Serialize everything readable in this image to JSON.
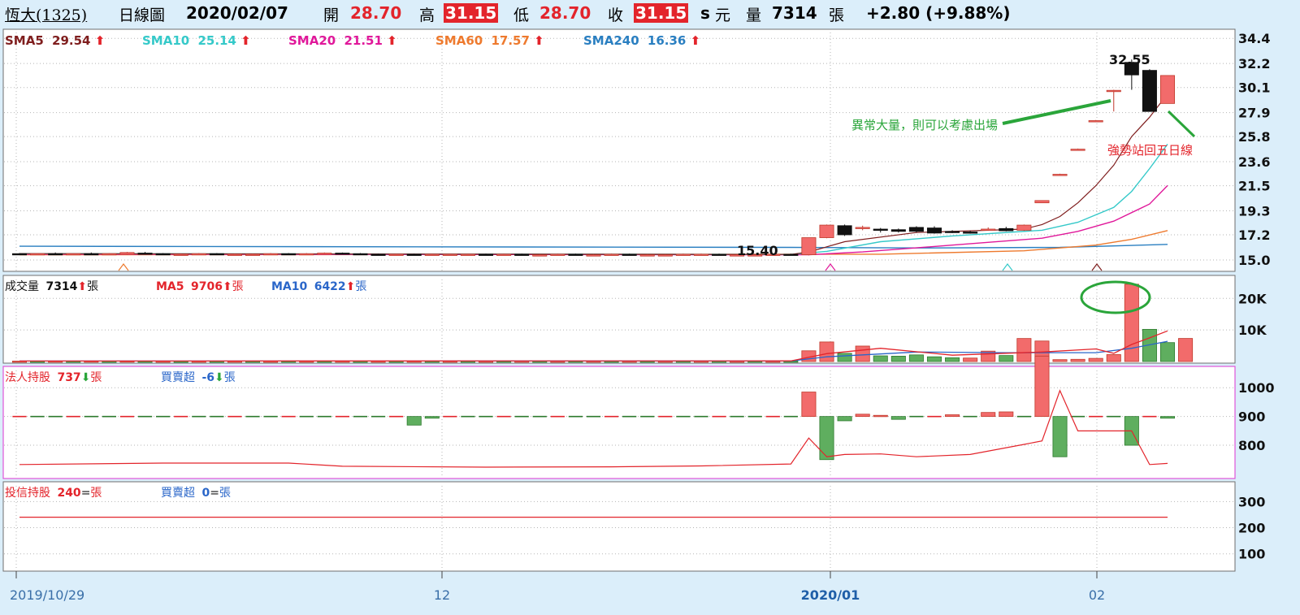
{
  "header": {
    "stock_name": "恆大(1325)",
    "chart_label": "日線圖",
    "date": "2020/02/07",
    "open_label": "開",
    "open": "28.70",
    "high_label": "高",
    "high": "31.15",
    "low_label": "低",
    "low": "28.70",
    "close_label": "收",
    "close": "31.15",
    "close_suffix": "s",
    "currency": "元",
    "volume_label": "量",
    "volume": "7314",
    "volume_unit": "張",
    "change": "+2.80 (+9.88%)"
  },
  "colors": {
    "up": "#f26b6b",
    "down": "#111111",
    "red": "#e3242b",
    "green": "#2aa53a",
    "sma5": "#7f1e1e",
    "sma10": "#35c9c9",
    "sma20": "#e0189a",
    "sma60": "#ee7a2e",
    "sma240": "#2a7fc1",
    "vol_ma5": "#e3242b",
    "vol_ma10": "#2a66c9",
    "accent": "#e3242b"
  },
  "chart_data": [
    {
      "type": "candlestick",
      "panel": "price",
      "indicators": [
        {
          "label": "SMA5",
          "value": "29.54"
        },
        {
          "label": "SMA10",
          "value": "25.14"
        },
        {
          "label": "SMA20",
          "value": "21.51"
        },
        {
          "label": "SMA60",
          "value": "17.57"
        },
        {
          "label": "SMA240",
          "value": "16.36"
        }
      ],
      "y_ticks": [
        "34.4",
        "32.2",
        "30.1",
        "27.9",
        "25.8",
        "23.6",
        "21.5",
        "19.3",
        "17.2",
        "15.0"
      ],
      "ylim": [
        14.0,
        35.2
      ],
      "x_ticks": [
        "2019/10/29",
        "12",
        "2020/01",
        "02"
      ],
      "min_label": "15.40",
      "max_label": "32.55",
      "annotations": [
        {
          "text": "異常大量，則可以考慮出場",
          "color": "green"
        },
        {
          "text": "強勢站回五日線",
          "color": "red"
        }
      ],
      "candles": [
        {
          "o": 15.55,
          "h": 15.6,
          "c": 15.5,
          "l": 15.45
        },
        {
          "o": 15.5,
          "h": 15.6,
          "c": 15.55,
          "l": 15.45
        },
        {
          "o": 15.55,
          "h": 15.65,
          "c": 15.5,
          "l": 15.45
        },
        {
          "o": 15.5,
          "h": 15.55,
          "c": 15.55,
          "l": 15.45
        },
        {
          "o": 15.55,
          "h": 15.65,
          "c": 15.5,
          "l": 15.5
        },
        {
          "o": 15.5,
          "h": 15.6,
          "c": 15.55,
          "l": 15.45
        },
        {
          "o": 15.5,
          "h": 15.7,
          "c": 15.65,
          "l": 15.45
        },
        {
          "o": 15.6,
          "h": 15.7,
          "c": 15.55,
          "l": 15.5
        },
        {
          "o": 15.55,
          "h": 15.6,
          "c": 15.5,
          "l": 15.45
        },
        {
          "o": 15.5,
          "h": 15.55,
          "c": 15.5,
          "l": 15.45
        },
        {
          "o": 15.5,
          "h": 15.6,
          "c": 15.55,
          "l": 15.45
        },
        {
          "o": 15.55,
          "h": 15.6,
          "c": 15.5,
          "l": 15.45
        },
        {
          "o": 15.5,
          "h": 15.55,
          "c": 15.5,
          "l": 15.45
        },
        {
          "o": 15.5,
          "h": 15.55,
          "c": 15.5,
          "l": 15.45
        },
        {
          "o": 15.5,
          "h": 15.6,
          "c": 15.55,
          "l": 15.45
        },
        {
          "o": 15.55,
          "h": 15.6,
          "c": 15.5,
          "l": 15.45
        },
        {
          "o": 15.5,
          "h": 15.6,
          "c": 15.55,
          "l": 15.45
        },
        {
          "o": 15.55,
          "h": 15.65,
          "c": 15.6,
          "l": 15.5
        },
        {
          "o": 15.6,
          "h": 15.65,
          "c": 15.55,
          "l": 15.5
        },
        {
          "o": 15.55,
          "h": 15.6,
          "c": 15.5,
          "l": 15.45
        },
        {
          "o": 15.5,
          "h": 15.55,
          "c": 15.45,
          "l": 15.4
        },
        {
          "o": 15.45,
          "h": 15.55,
          "c": 15.5,
          "l": 15.4
        },
        {
          "o": 15.5,
          "h": 15.55,
          "c": 15.45,
          "l": 15.4
        },
        {
          "o": 15.45,
          "h": 15.55,
          "c": 15.5,
          "l": 15.4
        },
        {
          "o": 15.5,
          "h": 15.55,
          "c": 15.5,
          "l": 15.45
        },
        {
          "o": 15.5,
          "h": 15.55,
          "c": 15.5,
          "l": 15.45
        },
        {
          "o": 15.5,
          "h": 15.55,
          "c": 15.45,
          "l": 15.4
        },
        {
          "o": 15.45,
          "h": 15.55,
          "c": 15.5,
          "l": 15.4
        },
        {
          "o": 15.5,
          "h": 15.55,
          "c": 15.45,
          "l": 15.4
        },
        {
          "o": 15.45,
          "h": 15.5,
          "c": 15.45,
          "l": 15.4
        },
        {
          "o": 15.45,
          "h": 15.55,
          "c": 15.5,
          "l": 15.4
        },
        {
          "o": 15.5,
          "h": 15.55,
          "c": 15.45,
          "l": 15.4
        },
        {
          "o": 15.45,
          "h": 15.5,
          "c": 15.45,
          "l": 15.4
        },
        {
          "o": 15.45,
          "h": 15.55,
          "c": 15.5,
          "l": 15.4
        },
        {
          "o": 15.5,
          "h": 15.55,
          "c": 15.45,
          "l": 15.4
        },
        {
          "o": 15.45,
          "h": 15.5,
          "c": 15.45,
          "l": 15.4
        },
        {
          "o": 15.45,
          "h": 15.5,
          "c": 15.45,
          "l": 15.4
        },
        {
          "o": 15.45,
          "h": 15.55,
          "c": 15.5,
          "l": 15.4
        },
        {
          "o": 15.5,
          "h": 15.55,
          "c": 15.5,
          "l": 15.45
        },
        {
          "o": 15.5,
          "h": 15.55,
          "c": 15.45,
          "l": 15.4
        },
        {
          "o": 15.45,
          "h": 15.5,
          "c": 15.45,
          "l": 15.4
        },
        {
          "o": 15.45,
          "h": 15.5,
          "c": 15.45,
          "l": 15.4
        },
        {
          "o": 15.45,
          "h": 15.55,
          "c": 15.5,
          "l": 15.4
        },
        {
          "o": 15.5,
          "h": 15.55,
          "c": 15.45,
          "l": 15.4
        },
        {
          "o": 15.45,
          "h": 16.95,
          "c": 16.95,
          "l": 15.4
        },
        {
          "o": 16.95,
          "h": 18.1,
          "c": 18.05,
          "l": 16.9
        },
        {
          "o": 18.0,
          "h": 18.1,
          "c": 17.2,
          "l": 17.1
        },
        {
          "o": 17.85,
          "h": 18.0,
          "c": 17.85,
          "l": 17.6
        },
        {
          "o": 17.7,
          "h": 17.8,
          "c": 17.6,
          "l": 17.4
        },
        {
          "o": 17.65,
          "h": 17.75,
          "c": 17.5,
          "l": 17.4
        },
        {
          "o": 17.85,
          "h": 17.95,
          "c": 17.5,
          "l": 17.4
        },
        {
          "o": 17.8,
          "h": 17.95,
          "c": 17.35,
          "l": 17.3
        },
        {
          "o": 17.5,
          "h": 17.6,
          "c": 17.45,
          "l": 17.35
        },
        {
          "o": 17.45,
          "h": 17.55,
          "c": 17.4,
          "l": 17.3
        },
        {
          "o": 17.6,
          "h": 17.85,
          "c": 17.7,
          "l": 17.55
        },
        {
          "o": 17.75,
          "h": 17.9,
          "c": 17.55,
          "l": 17.5
        },
        {
          "o": 17.6,
          "h": 18.1,
          "c": 18.05,
          "l": 17.55
        },
        {
          "o": 20.0,
          "h": 20.2,
          "c": 20.2,
          "l": 20.0
        },
        {
          "o": 22.5,
          "h": 22.55,
          "c": 22.5,
          "l": 22.5
        },
        {
          "o": 24.7,
          "h": 24.75,
          "c": 24.7,
          "l": 24.7
        },
        {
          "o": 27.2,
          "h": 27.25,
          "c": 27.2,
          "l": 27.2
        },
        {
          "o": 29.85,
          "h": 29.9,
          "c": 29.85,
          "l": 28.0
        },
        {
          "o": 32.3,
          "h": 32.55,
          "c": 31.2,
          "l": 29.9
        },
        {
          "o": 31.6,
          "h": 31.7,
          "c": 28.0,
          "l": 28.0
        },
        {
          "o": 28.7,
          "h": 31.15,
          "c": 31.15,
          "l": 28.7
        }
      ],
      "sma5": [
        [
          0,
          15.55
        ],
        [
          43,
          15.48
        ],
        [
          44,
          15.7
        ],
        [
          46,
          16.6
        ],
        [
          50,
          17.4
        ],
        [
          56,
          17.7
        ],
        [
          57,
          18.1
        ],
        [
          58,
          18.8
        ],
        [
          59,
          20.0
        ],
        [
          60,
          21.5
        ],
        [
          61,
          23.3
        ],
        [
          62,
          25.8
        ],
        [
          63,
          27.5
        ],
        [
          64,
          29.54
        ]
      ],
      "sma10": [
        [
          0,
          15.55
        ],
        [
          43,
          15.48
        ],
        [
          45,
          15.75
        ],
        [
          48,
          16.6
        ],
        [
          52,
          17.1
        ],
        [
          57,
          17.6
        ],
        [
          59,
          18.3
        ],
        [
          61,
          19.6
        ],
        [
          62,
          21.0
        ],
        [
          63,
          23.0
        ],
        [
          64,
          25.14
        ]
      ],
      "sma20": [
        [
          0,
          15.5
        ],
        [
          44,
          15.45
        ],
        [
          47,
          15.7
        ],
        [
          52,
          16.3
        ],
        [
          57,
          16.9
        ],
        [
          59,
          17.5
        ],
        [
          61,
          18.4
        ],
        [
          63,
          19.9
        ],
        [
          64,
          21.51
        ]
      ],
      "sma60": [
        [
          0,
          15.45
        ],
        [
          48,
          15.5
        ],
        [
          56,
          15.8
        ],
        [
          60,
          16.3
        ],
        [
          62,
          16.8
        ],
        [
          64,
          17.57
        ]
      ],
      "sma240": [
        [
          0,
          16.2
        ],
        [
          43,
          16.1
        ],
        [
          50,
          16.05
        ],
        [
          58,
          16.1
        ],
        [
          64,
          16.36
        ]
      ]
    },
    {
      "type": "bar",
      "panel": "volume",
      "label": "成交量",
      "value": "7314",
      "unit": "張",
      "indicators": [
        {
          "label": "MA5",
          "value": "9706",
          "unit": "張"
        },
        {
          "label": "MA10",
          "value": "6422",
          "unit": "張"
        }
      ],
      "y_ticks": [
        "20K",
        "10K"
      ],
      "ylim": [
        0,
        26000
      ],
      "values": [
        150,
        140,
        160,
        150,
        170,
        140,
        180,
        150,
        140,
        130,
        150,
        140,
        150,
        150,
        140,
        160,
        150,
        150,
        160,
        140,
        150,
        140,
        160,
        150,
        150,
        150,
        140,
        160,
        150,
        150,
        140,
        160,
        150,
        140,
        150,
        150,
        140,
        160,
        150,
        150,
        140,
        160,
        150,
        150,
        3400,
        6200,
        2600,
        4900,
        1800,
        1700,
        2100,
        1500,
        1200,
        1100,
        3300,
        1900,
        7300,
        6500,
        600,
        700,
        1000,
        2200,
        24500,
        10200,
        6000,
        7314
      ],
      "up": [
        1,
        0,
        1,
        0,
        1,
        0,
        1,
        0,
        1,
        0,
        1,
        0,
        1,
        0,
        1,
        0,
        1,
        0,
        1,
        0,
        1,
        0,
        1,
        0,
        1,
        0,
        1,
        0,
        1,
        0,
        1,
        0,
        1,
        0,
        1,
        0,
        1,
        0,
        1,
        0,
        1,
        0,
        1,
        0,
        1,
        1,
        0,
        1,
        0,
        0,
        0,
        0,
        0,
        1,
        1,
        0,
        1,
        1,
        1,
        1,
        1,
        1,
        1,
        0,
        0,
        1
      ],
      "ma5": [
        [
          0,
          150
        ],
        [
          43,
          200
        ],
        [
          45,
          2500
        ],
        [
          48,
          4200
        ],
        [
          52,
          2000
        ],
        [
          57,
          3000
        ],
        [
          60,
          4000
        ],
        [
          61,
          2600
        ],
        [
          62,
          5400
        ],
        [
          63,
          7500
        ],
        [
          64,
          9706
        ]
      ],
      "ma10": [
        [
          0,
          150
        ],
        [
          43,
          170
        ],
        [
          45,
          1500
        ],
        [
          50,
          3000
        ],
        [
          55,
          2800
        ],
        [
          60,
          2800
        ],
        [
          62,
          4200
        ],
        [
          64,
          6422
        ]
      ]
    },
    {
      "type": "bar",
      "panel": "institutional",
      "label": "法人持股",
      "value": "737",
      "unit": "張",
      "net_label": "買賣超",
      "net_value": "-6",
      "net_unit": "張",
      "y_ticks": [
        "1000",
        "900",
        "800"
      ],
      "ylim": [
        690,
        1060
      ],
      "baseline": 900,
      "net": [
        [
          22,
          -30
        ],
        [
          23,
          -6
        ],
        [
          44,
          85
        ],
        [
          45,
          -150
        ],
        [
          46,
          -15
        ],
        [
          47,
          8
        ],
        [
          48,
          4
        ],
        [
          49,
          -10
        ],
        [
          52,
          6
        ],
        [
          54,
          14
        ],
        [
          55,
          16
        ],
        [
          57,
          210
        ],
        [
          58,
          -140
        ],
        [
          62,
          -100
        ],
        [
          64,
          -6
        ]
      ],
      "holdings": [
        [
          0,
          733
        ],
        [
          8,
          738
        ],
        [
          15,
          738
        ],
        [
          18,
          727
        ],
        [
          26,
          724
        ],
        [
          33,
          725
        ],
        [
          38,
          728
        ],
        [
          43,
          735
        ],
        [
          44,
          825
        ],
        [
          45,
          760
        ],
        [
          46,
          768
        ],
        [
          48,
          770
        ],
        [
          50,
          760
        ],
        [
          53,
          768
        ],
        [
          56,
          803
        ],
        [
          57,
          815
        ],
        [
          58,
          990
        ],
        [
          59,
          850
        ],
        [
          62,
          850
        ],
        [
          63,
          733
        ],
        [
          64,
          737
        ]
      ]
    },
    {
      "type": "line",
      "panel": "investment_trust",
      "label": "投信持股",
      "value": "240",
      "unit": "張",
      "net_label": "買賣超",
      "net_value": "0",
      "net_unit": "張",
      "y_ticks": [
        "300",
        "200",
        "100"
      ],
      "ylim": [
        40,
        360
      ],
      "values": [
        [
          0,
          240
        ],
        [
          64,
          240
        ]
      ]
    }
  ]
}
